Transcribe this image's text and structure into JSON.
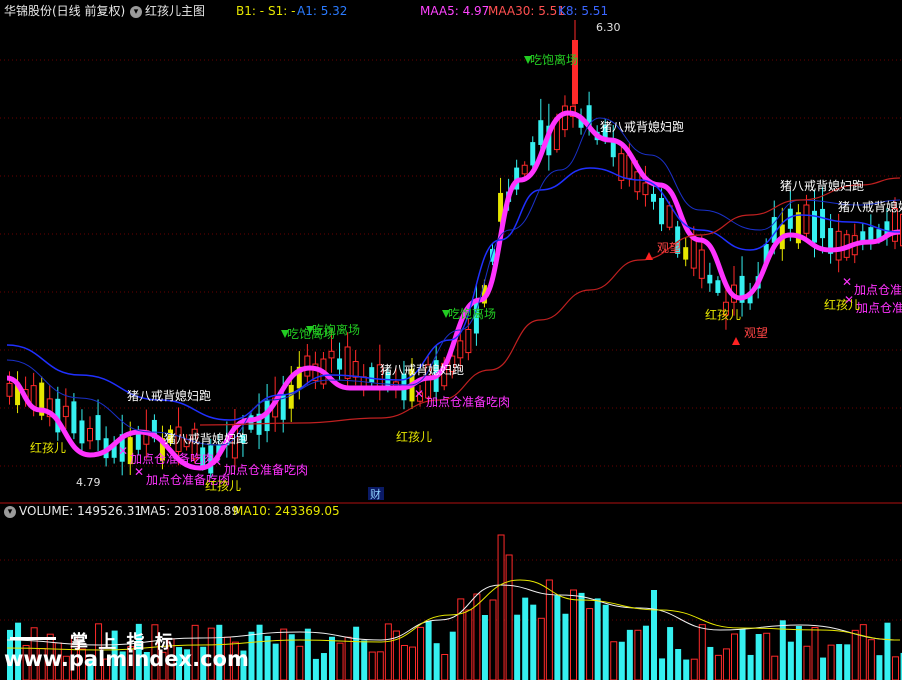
{
  "header": {
    "stock_name": "华锦股份(日线 前复权)",
    "indicator": "红孩儿主图",
    "b1": "B1: -",
    "s1": "S1: -",
    "a1": "A1: 5.32",
    "maa5": "MAA5: 4.97",
    "maa30": "MAA30: 5.51",
    "k8": "K8: 5.51"
  },
  "volume_header": {
    "volume": "VOLUME: 149526.31",
    "ma5": "MA5: 203108.89",
    "ma10": "MA10: 243369.05"
  },
  "price_labels": {
    "high": "6.30",
    "low": "4.79"
  },
  "annotations": [
    {
      "text": "吃饱离场",
      "kind": "sell"
    },
    {
      "text": "吃饱离场",
      "kind": "sell"
    },
    {
      "text": "吃饱离场",
      "kind": "sell"
    },
    {
      "text": "吃饱离场",
      "kind": "sell"
    },
    {
      "text": "猪八戒背媳妇跑",
      "kind": "white"
    },
    {
      "text": "猪八戒背媳妇跑",
      "kind": "white"
    },
    {
      "text": "猪八戒背媳妇跑",
      "kind": "white"
    },
    {
      "text": "猪八戒背媳妇跑",
      "kind": "white"
    },
    {
      "text": "猪八戒背媳妇跑",
      "kind": "white"
    },
    {
      "text": "猪八戒背媳妇跑",
      "kind": "white"
    },
    {
      "text": "加点仓准备吃肉",
      "kind": "magenta"
    },
    {
      "text": "加点仓准备吃肉",
      "kind": "magenta"
    },
    {
      "text": "加点仓准备吃肉",
      "kind": "magenta"
    },
    {
      "text": "加点仓准备吃肉",
      "kind": "magenta"
    },
    {
      "text": "加点仓准",
      "kind": "magenta"
    },
    {
      "text": "加点仓准备吃肉",
      "kind": "magenta"
    },
    {
      "text": "红孩儿",
      "kind": "yellow"
    },
    {
      "text": "红孩儿",
      "kind": "yellow"
    },
    {
      "text": "红孩儿",
      "kind": "yellow"
    },
    {
      "text": "红孩儿",
      "kind": "yellow"
    },
    {
      "text": "红孩儿",
      "kind": "yellow"
    },
    {
      "text": "观望",
      "kind": "red"
    },
    {
      "text": "观望",
      "kind": "red"
    }
  ],
  "event_marker": "财",
  "watermark": {
    "title": "掌 上 指 标",
    "url": "www.palmindex.com"
  },
  "colors": {
    "up": "#ff2a2a",
    "down": "#35f0f0",
    "yellow": "#e6e600",
    "magenta": "#ff33ff",
    "blue": "#2030ff",
    "red_ma": "#c02020",
    "green": "#22cc22"
  }
}
